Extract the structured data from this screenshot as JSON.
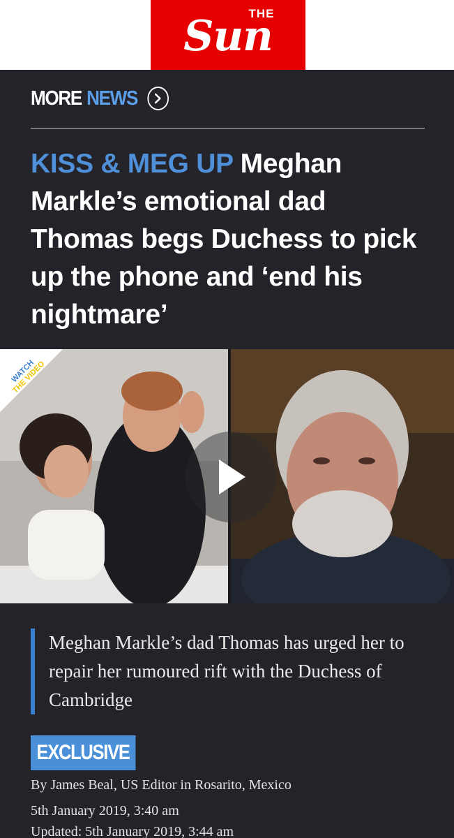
{
  "header": {
    "brand_the": "THE",
    "brand_name": "Sun",
    "brand_color": "#e60000"
  },
  "section": {
    "more": "MORE",
    "news": "NEWS",
    "arrow_icon": "chevron-right-circle-icon"
  },
  "article": {
    "kicker": "KISS & MEG UP",
    "headline": "Meghan Markle’s emotional dad Thomas begs Duchess to pick up the phone and ‘end his nightmare’",
    "media": {
      "badge_line1": "WATCH",
      "badge_line2": "THE VIDEO",
      "play_icon": "play-icon"
    },
    "standfirst": "Meghan Markle’s dad Thomas has urged her to repair her rumoured rift with the Duchess of Cambridge",
    "tag": "EXCLUSIVE",
    "byline": "By James Beal, US Editor in Rosarito, Mexico",
    "published": "5th January 2019, 3:40 am",
    "updated": "Updated: 5th January 2019, 3:44 am"
  },
  "colors": {
    "background": "#242329",
    "accent_blue": "#4a90d9",
    "text": "#ffffff"
  }
}
